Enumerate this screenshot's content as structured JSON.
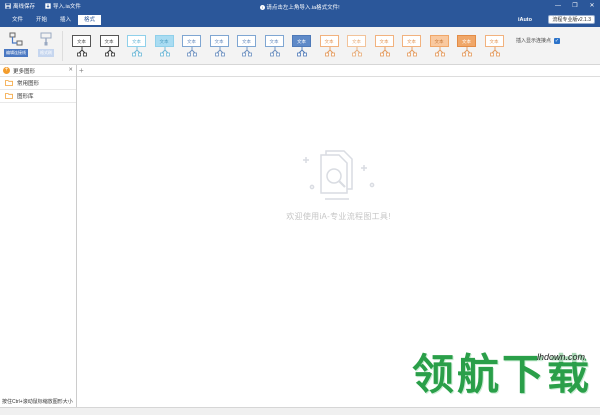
{
  "titlebar": {
    "save_label": "离线保存",
    "import_label": "导入.ia文件",
    "notice": "请点击左上角导入.ia格式文件!",
    "minimize": "—",
    "restore": "❐",
    "close": "✕"
  },
  "menubar": {
    "items": [
      {
        "label": "文件"
      },
      {
        "label": "开始"
      },
      {
        "label": "插入"
      },
      {
        "label": "格式",
        "active": true
      }
    ],
    "brand": "iAuto",
    "version": "流程专业版v2.1.3"
  },
  "ribbon": {
    "connector_label": "编辑连接线",
    "format_label": "格式刷",
    "style_text": "文本",
    "styles": [
      {
        "bg": "#ffffff",
        "border": "#555555",
        "text": "#555555",
        "icon": "#333333"
      },
      {
        "bg": "#ffffff",
        "border": "#555555",
        "text": "#555555",
        "icon": "#333333"
      },
      {
        "bg": "#ffffff",
        "border": "#8fd0ea",
        "text": "#6cb8d8",
        "icon": "#6cb8d8"
      },
      {
        "bg": "#a9dcf2",
        "border": "#8fd0ea",
        "text": "#4f9fc2",
        "icon": "#6cb8d8"
      },
      {
        "bg": "#ffffff",
        "border": "#7fa6d2",
        "text": "#6b8fc0",
        "icon": "#6b8fc0"
      },
      {
        "bg": "#ffffff",
        "border": "#7fa6d2",
        "text": "#6b8fc0",
        "icon": "#6b8fc0"
      },
      {
        "bg": "#ffffff",
        "border": "#7fa6d2",
        "text": "#6b8fc0",
        "icon": "#6b8fc0"
      },
      {
        "bg": "#ffffff",
        "border": "#7fa6d2",
        "text": "#6b8fc0",
        "icon": "#6b8fc0"
      },
      {
        "bg": "#5f8ac8",
        "border": "#4e79b8",
        "text": "#ffffff",
        "icon": "#4e79b8"
      },
      {
        "bg": "#ffffff",
        "border": "#f2b27e",
        "text": "#e49a5c",
        "icon": "#e49a5c"
      },
      {
        "bg": "#ffffff",
        "border": "#f2c39a",
        "text": "#e8ad7a",
        "icon": "#e8ad7a"
      },
      {
        "bg": "#ffffff",
        "border": "#f2b27e",
        "text": "#e49a5c",
        "icon": "#e49a5c"
      },
      {
        "bg": "#ffffff",
        "border": "#f2b27e",
        "text": "#e49a5c",
        "icon": "#e49a5c"
      },
      {
        "bg": "#f9c9a0",
        "border": "#f0a769",
        "text": "#c87a3a",
        "icon": "#e49a5c"
      },
      {
        "bg": "#f0a769",
        "border": "#e38c46",
        "text": "#ffffff",
        "icon": "#e49a5c"
      },
      {
        "bg": "#ffffff",
        "border": "#f2b27e",
        "text": "#e49a5c",
        "icon": "#e49a5c"
      }
    ],
    "inline_label": "插入显示连接点",
    "inline_checked": "✓"
  },
  "sidebar": {
    "header": "更多图形",
    "close": "✕",
    "items": [
      {
        "label": "常用图形"
      },
      {
        "label": "图形库"
      }
    ],
    "hint": "按住Ctrl+滚动鼠标缩放图形大小"
  },
  "canvas": {
    "add_tab": "+",
    "welcome": "欢迎使用iA-专业流程图工具!"
  },
  "watermark": {
    "logo": "领航下载",
    "url": "lhdown.com"
  },
  "colors": {
    "accent": "#2b579a",
    "folder": "#f3a33a",
    "plus_circle": "#f39c2b",
    "watermark": "#2a9f49"
  }
}
